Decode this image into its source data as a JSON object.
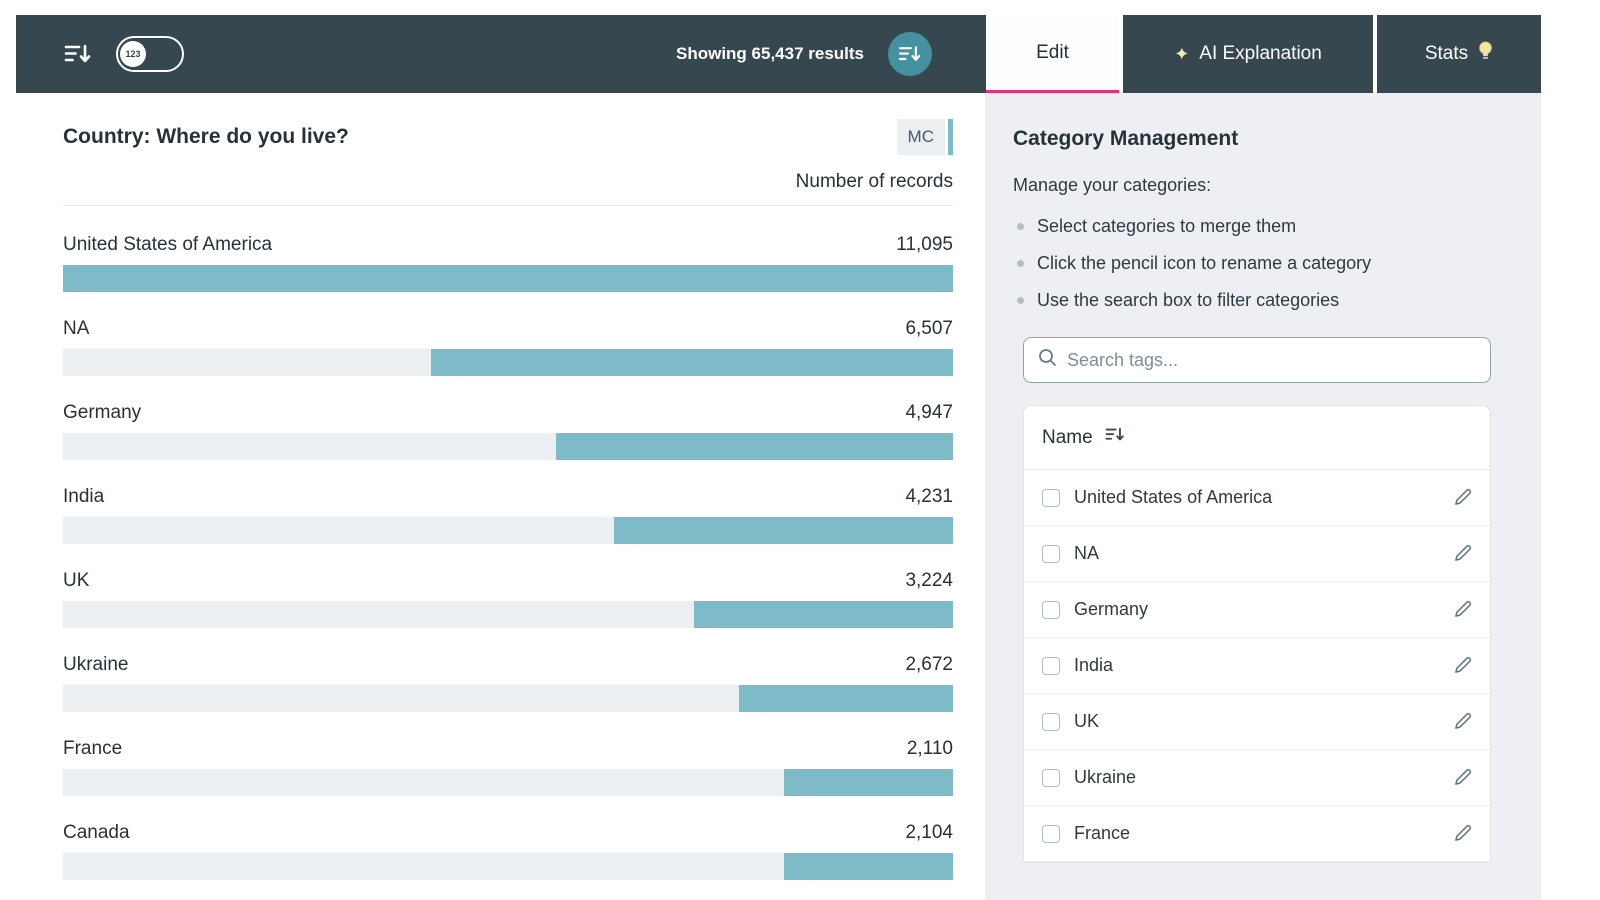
{
  "header": {
    "toggle_badge": "123",
    "results_text": "Showing 65,437 results",
    "tabs": {
      "edit": "Edit",
      "ai": "AI Explanation",
      "stats": "Stats"
    }
  },
  "chart": {
    "question_title": "Country: Where do you live?",
    "type_badge": "MC",
    "column_header": "Number of records",
    "chart_data": {
      "type": "bar",
      "orientation": "horizontal",
      "categories": [
        "United States of America",
        "NA",
        "Germany",
        "India",
        "UK",
        "Ukraine",
        "France",
        "Canada"
      ],
      "values": [
        11095,
        6507,
        4947,
        4231,
        3224,
        2672,
        2110,
        2104
      ],
      "max_value": 11095,
      "value_axis_label": "Number of records",
      "fill_anchor": "right",
      "bar_color": "#7EBBC8",
      "track_color": "#ECEFF1"
    }
  },
  "panel": {
    "title": "Category Management",
    "subtitle": "Manage your categories:",
    "instructions": [
      "Select categories to merge them",
      "Click the pencil icon to rename a category",
      "Use the search box to filter categories"
    ],
    "search_placeholder": "Search tags...",
    "table": {
      "name_header": "Name",
      "rows": [
        "United States of America",
        "NA",
        "Germany",
        "India",
        "UK",
        "Ukraine",
        "France"
      ]
    }
  },
  "colors": {
    "header_bg": "#37474F",
    "bar_teal": "#7EBBC8",
    "button_teal": "#45919F",
    "accent_pink": "#E62E7B",
    "panel_bg": "#EDEFF2"
  }
}
